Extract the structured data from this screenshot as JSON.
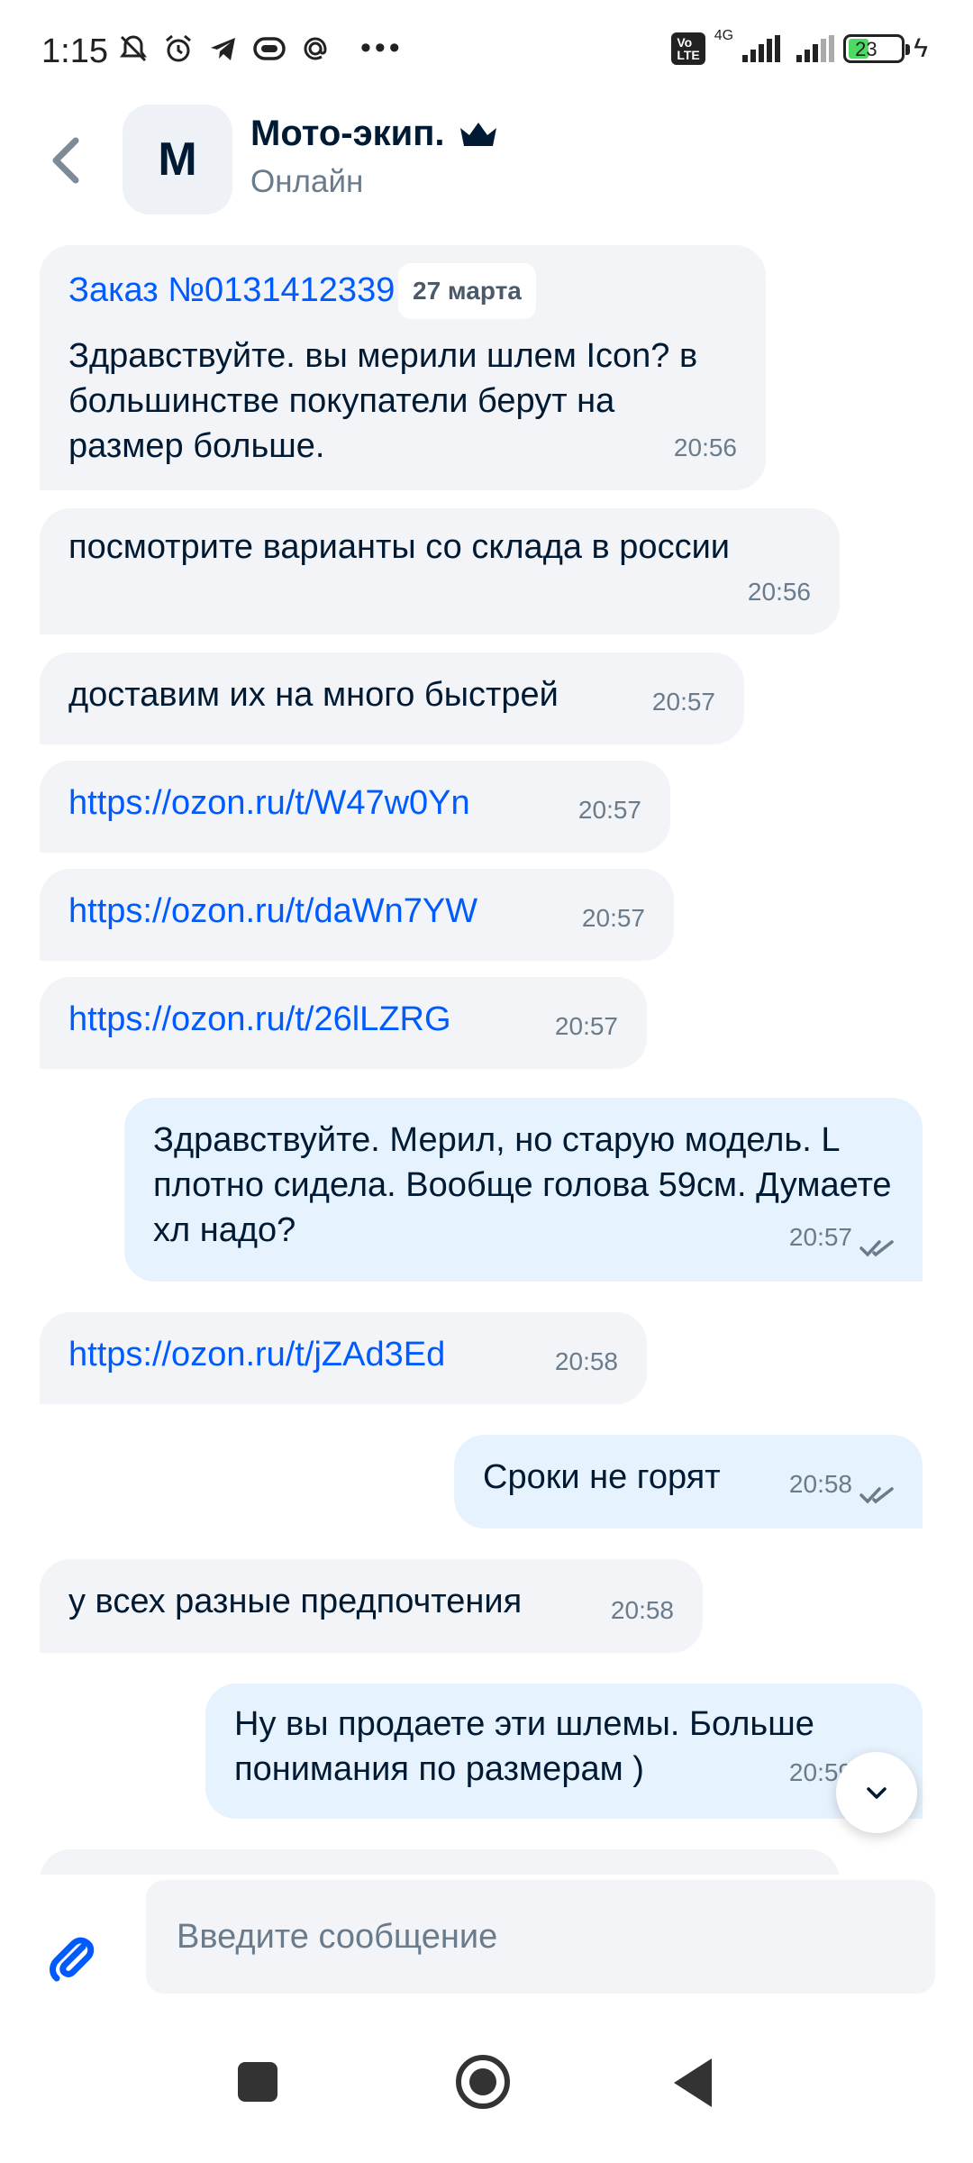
{
  "status_bar": {
    "time": "1:15",
    "network_label": "4G",
    "volte_label": "Vo LTE",
    "battery_level": "23",
    "icons": [
      "muted-bell-icon",
      "alarm-icon",
      "telegram-icon",
      "sleep-mask-icon",
      "at-icon",
      "more-dots-icon"
    ]
  },
  "header": {
    "avatar_letter": "М",
    "chat_name": "Мото-экип.",
    "status": "Онлайн"
  },
  "messages": [
    {
      "title": "Заказ №0131412339",
      "date": "27 марта",
      "text": "Здравствуйте. вы мерили шлем Icon? в большинстве покупатели берут на размер больше.",
      "time": "20:56"
    },
    {
      "text": "посмотрите варианты со склада в россии",
      "time": "20:56"
    },
    {
      "text": "доставим их на много быстрей",
      "time": "20:57"
    },
    {
      "text": "https://ozon.ru/t/W47w0Yn",
      "time": "20:57"
    },
    {
      "text": "https://ozon.ru/t/daWn7YW",
      "time": "20:57"
    },
    {
      "text": "https://ozon.ru/t/26lLZRG",
      "time": "20:57"
    },
    {
      "text": "Здравствуйте. Мерил, но старую модель. L плотно сидела. Вообще голова 59см. Думаете хл надо?",
      "time": "20:57"
    },
    {
      "text": "https://ozon.ru/t/jZAd3Ed",
      "time": "20:58"
    },
    {
      "text": "Сроки не горят",
      "time": "20:58"
    },
    {
      "text": "у всех разные предпочтения",
      "time": "20:58"
    },
    {
      "text": "Ну вы продаете эти шлемы. Больше понимания по размерам )",
      "time": "20:59"
    }
  ],
  "input": {
    "placeholder": "Введите сообщение"
  },
  "colors": {
    "accent": "#005bff",
    "incoming_bubble": "#f2f4f7",
    "outgoing_bubble": "#e6f2fd",
    "secondary_text": "#6a7b8c"
  }
}
